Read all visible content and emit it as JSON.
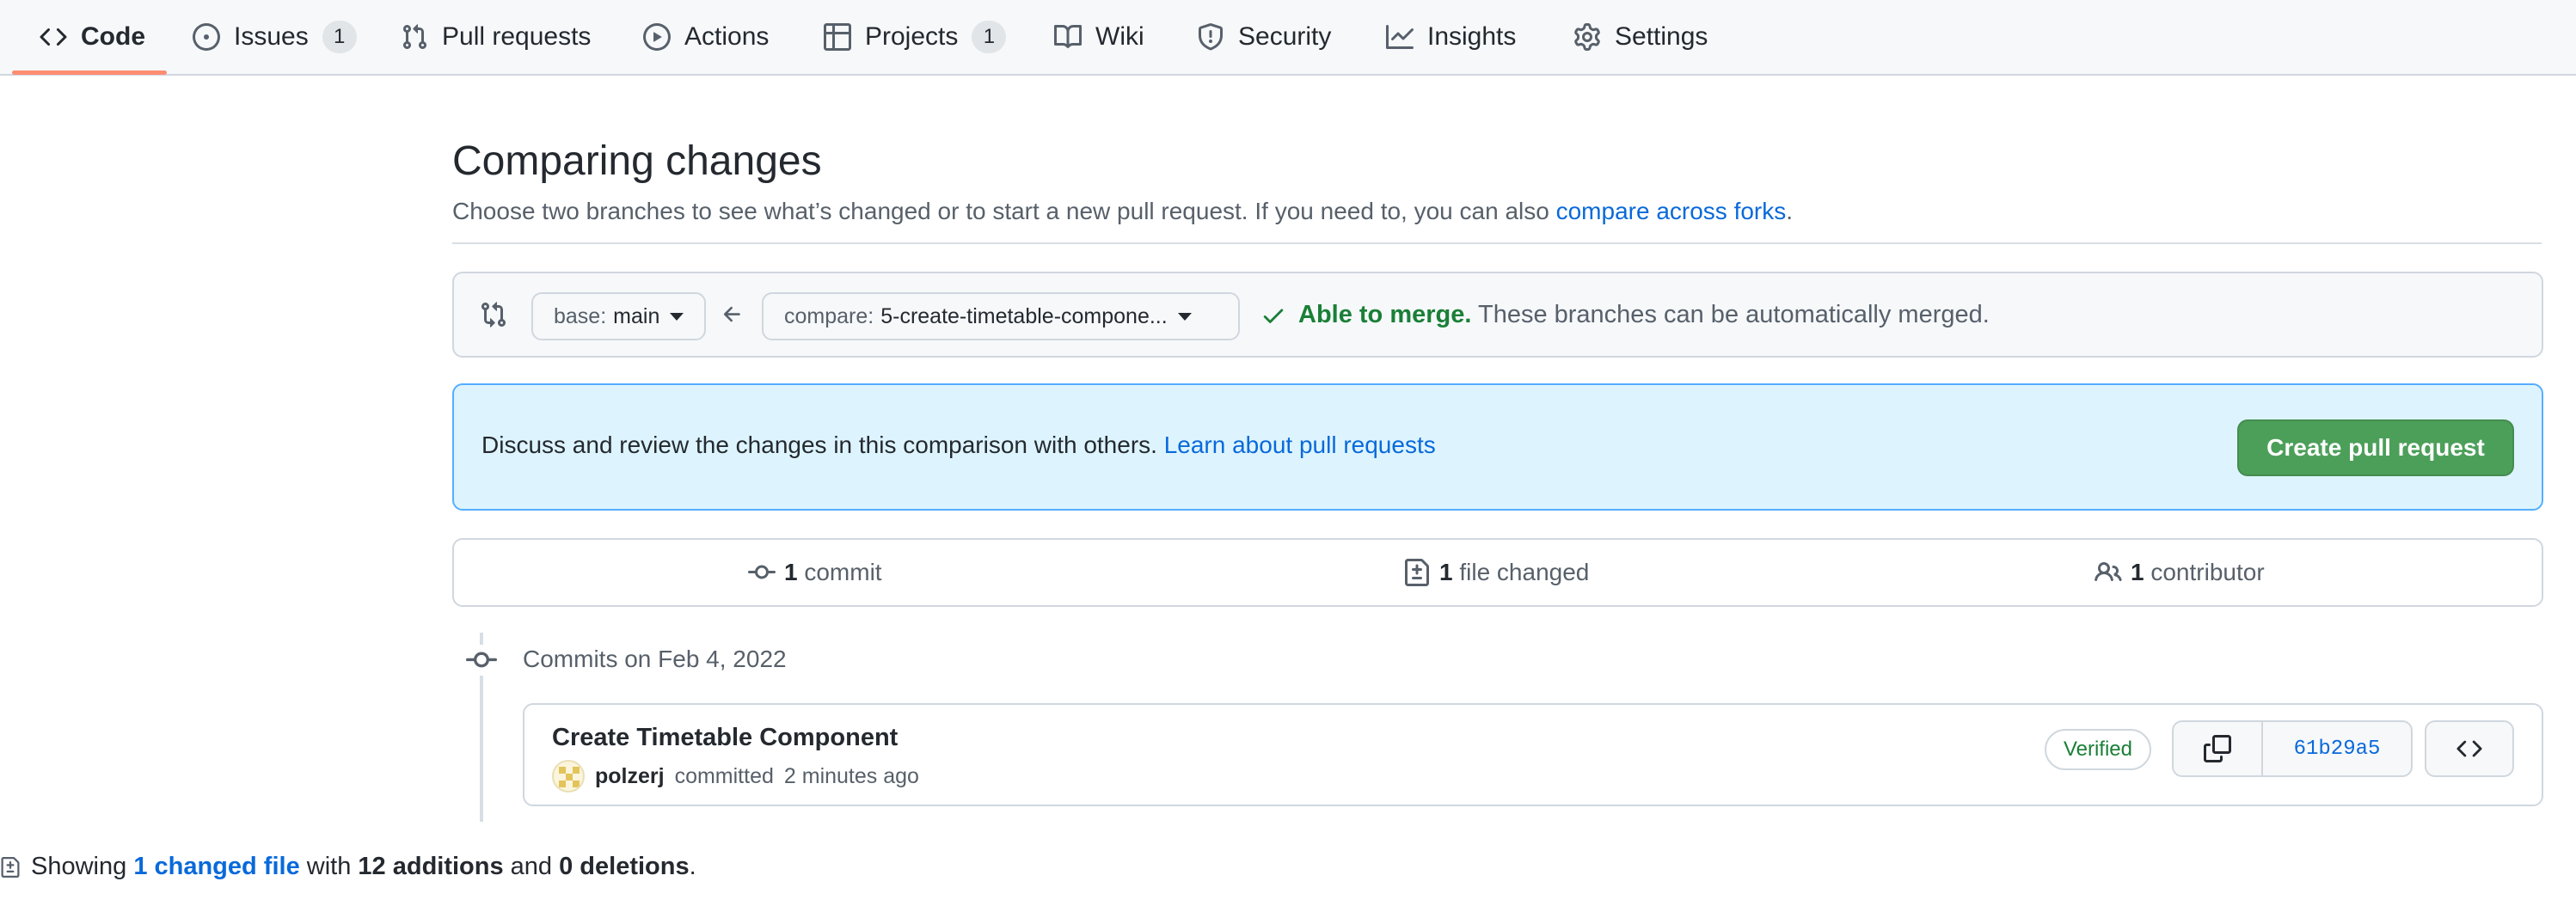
{
  "nav": {
    "items": [
      {
        "label": "Code",
        "icon": "code-icon",
        "selected": true
      },
      {
        "label": "Issues",
        "icon": "issue-opened-icon",
        "count": "1"
      },
      {
        "label": "Pull requests",
        "icon": "git-pull-request-icon"
      },
      {
        "label": "Actions",
        "icon": "play-icon"
      },
      {
        "label": "Projects",
        "icon": "table-icon",
        "count": "1"
      },
      {
        "label": "Wiki",
        "icon": "book-icon"
      },
      {
        "label": "Security",
        "icon": "shield-icon"
      },
      {
        "label": "Insights",
        "icon": "graph-icon"
      },
      {
        "label": "Settings",
        "icon": "gear-icon"
      }
    ]
  },
  "header": {
    "title": "Comparing changes",
    "subtitle": "Choose two branches to see what’s changed or to start a new pull request. If you need to, you can also",
    "subtitle_link": "compare across forks",
    "subtitle_end": "."
  },
  "range": {
    "base_prefix": "base:",
    "base_branch": "main",
    "compare_prefix": "compare:",
    "compare_branch": "5-create-timetable-compone...",
    "merge_status": "Able to merge.",
    "merge_detail": "These branches can be automatically merged."
  },
  "blankslate": {
    "text": "Discuss and review the changes in this comparison with others.",
    "link": "Learn about pull requests",
    "button": "Create pull request"
  },
  "summary": {
    "commits_num": "1",
    "commits_label": "commit",
    "files_num": "1",
    "files_label": "file changed",
    "contributors_num": "1",
    "contributors_label": "contributor"
  },
  "commits": {
    "date_heading": "Commits on Feb 4, 2022",
    "items": [
      {
        "title": "Create Timetable Component",
        "author": "polzerj",
        "action": "committed",
        "time": "2 minutes ago",
        "badge": "Verified",
        "sha": "61b29a5"
      }
    ]
  },
  "toc": {
    "prefix": "Showing",
    "files_link": "1 changed file",
    "with": "with",
    "additions": "12 additions",
    "and": "and",
    "deletions": "0 deletions",
    "end": "."
  },
  "colors": {
    "accent_link": "#0969da",
    "success": "#1a7f37",
    "primary_button": "#4c9f59",
    "nav_underline": "#fd8c73",
    "blankslate_bg": "#ddf4ff"
  }
}
